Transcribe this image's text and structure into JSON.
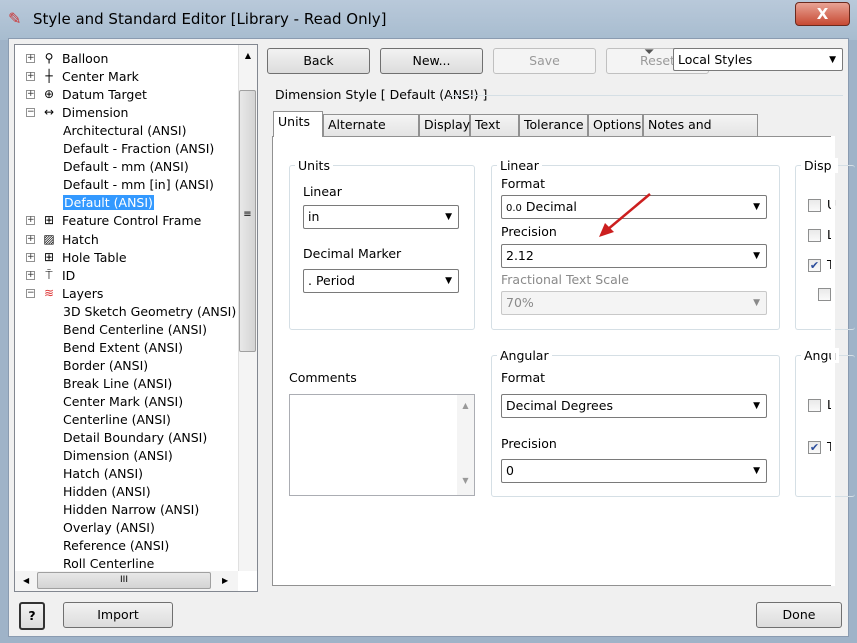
{
  "window": {
    "title": "Style and Standard Editor [Library - Read Only]",
    "close_label": "X"
  },
  "tree": {
    "items": [
      {
        "label": "Balloon",
        "icon": "balloon-icon",
        "glyph": "⚲",
        "expander": "+"
      },
      {
        "label": "Center Mark",
        "icon": "center-mark-icon",
        "glyph": "┼",
        "expander": "+"
      },
      {
        "label": "Datum Target",
        "icon": "datum-target-icon",
        "glyph": "⊕",
        "expander": "+"
      },
      {
        "label": "Dimension",
        "icon": "dimension-icon",
        "glyph": "↔",
        "expander": "−"
      },
      {
        "label": "Architectural (ANSI)",
        "child": true
      },
      {
        "label": "Default - Fraction (ANSI)",
        "child": true
      },
      {
        "label": "Default - mm (ANSI)",
        "child": true
      },
      {
        "label": "Default - mm [in] (ANSI)",
        "child": true
      },
      {
        "label": "Default (ANSI)",
        "child": true,
        "selected": true
      },
      {
        "label": "Feature Control Frame",
        "icon": "feature-control-frame-icon",
        "glyph": "⊞",
        "expander": "+"
      },
      {
        "label": "Hatch",
        "icon": "hatch-icon",
        "glyph": "▨",
        "expander": "+"
      },
      {
        "label": "Hole Table",
        "icon": "hole-table-icon",
        "glyph": "⊞",
        "expander": "+"
      },
      {
        "label": "ID",
        "icon": "id-icon",
        "glyph": "⍑",
        "expander": "+"
      },
      {
        "label": "Layers",
        "icon": "layers-icon",
        "glyph": "≋",
        "expander": "−"
      },
      {
        "label": "3D Sketch Geometry (ANSI)",
        "child": true
      },
      {
        "label": "Bend Centerline (ANSI)",
        "child": true
      },
      {
        "label": "Bend Extent (ANSI)",
        "child": true
      },
      {
        "label": "Border (ANSI)",
        "child": true
      },
      {
        "label": "Break Line (ANSI)",
        "child": true
      },
      {
        "label": "Center Mark (ANSI)",
        "child": true
      },
      {
        "label": "Centerline (ANSI)",
        "child": true
      },
      {
        "label": "Detail Boundary (ANSI)",
        "child": true
      },
      {
        "label": "Dimension (ANSI)",
        "child": true
      },
      {
        "label": "Hatch (ANSI)",
        "child": true
      },
      {
        "label": "Hidden (ANSI)",
        "child": true
      },
      {
        "label": "Hidden Narrow (ANSI)",
        "child": true
      },
      {
        "label": "Overlay (ANSI)",
        "child": true
      },
      {
        "label": "Reference (ANSI)",
        "child": true
      },
      {
        "label": "Roll Centerline",
        "child": true
      }
    ]
  },
  "toolbar": {
    "back": "Back",
    "new": "New...",
    "save": "Save",
    "reset": "Reset",
    "filter": "Local Styles"
  },
  "style_header": "Dimension Style [ Default (ANSI) ]",
  "tabs": [
    "Units",
    "Alternate Units",
    "Display",
    "Text",
    "Tolerance",
    "Options",
    "Notes and Leaders"
  ],
  "units": {
    "group": "Units",
    "linear_label": "Linear",
    "linear_value": "in",
    "decimal_marker_label": "Decimal Marker",
    "decimal_marker_value": ". Period"
  },
  "linear": {
    "group": "Linear",
    "format_label": "Format",
    "format_prefix": "0.0",
    "format_value": "Decimal",
    "precision_label": "Precision",
    "precision_value": "2.12",
    "fractional_label": "Fractional Text Scale",
    "fractional_value": "70%"
  },
  "display": {
    "group": "Displ",
    "items": [
      {
        "label": "U",
        "checked": false
      },
      {
        "label": "L",
        "checked": false
      },
      {
        "label": "T",
        "checked": true
      },
      {
        "label": "",
        "checked": false
      }
    ]
  },
  "comments_label": "Comments",
  "angular": {
    "group": "Angular",
    "format_label": "Format",
    "format_value": "Decimal Degrees",
    "precision_label": "Precision",
    "precision_value": "0"
  },
  "angular_display": {
    "group": "Angu",
    "items": [
      {
        "label": "L",
        "checked": false
      },
      {
        "label": "T",
        "checked": true
      }
    ]
  },
  "footer": {
    "help": "?",
    "import": "Import",
    "done": "Done"
  },
  "colors": {
    "selection": "#3399ff",
    "arrow": "#cc1f1f"
  }
}
